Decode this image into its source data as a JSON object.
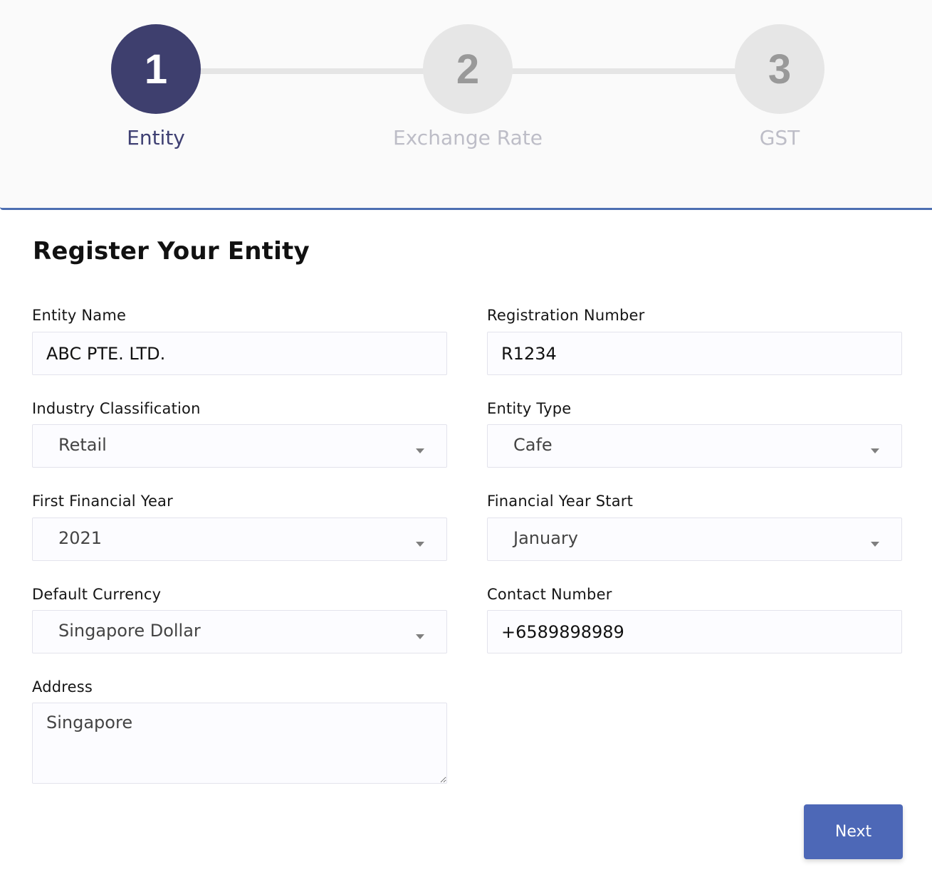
{
  "stepper": {
    "steps": [
      {
        "number": "1",
        "label": "Entity"
      },
      {
        "number": "2",
        "label": "Exchange Rate"
      },
      {
        "number": "3",
        "label": "GST"
      }
    ]
  },
  "form": {
    "title": "Register Your Entity",
    "fields": {
      "entity_name": {
        "label": "Entity Name",
        "value": "ABC PTE. LTD."
      },
      "registration_number": {
        "label": "Registration Number",
        "value": "R1234"
      },
      "industry_classification": {
        "label": "Industry Classification",
        "value": "Retail"
      },
      "entity_type": {
        "label": "Entity Type",
        "value": "Cafe"
      },
      "first_financial_year": {
        "label": "First Financial Year",
        "value": "2021"
      },
      "financial_year_start": {
        "label": "Financial Year Start",
        "value": "January"
      },
      "default_currency": {
        "label": "Default Currency",
        "value": "Singapore Dollar"
      },
      "contact_number": {
        "label": "Contact Number",
        "value": "+6589898989"
      },
      "address": {
        "label": "Address",
        "value": "Singapore"
      }
    },
    "next_label": "Next"
  },
  "colors": {
    "active_step": "#3e3f6e",
    "inactive_step": "#e6e6e6",
    "accent": "#4d68b7"
  },
  "icons": {
    "dropdown": "chevron-down-icon"
  }
}
